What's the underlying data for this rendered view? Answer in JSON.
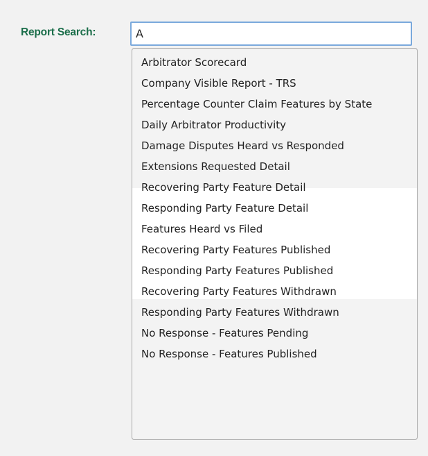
{
  "search": {
    "label": "Report Search:",
    "value": "A"
  },
  "results": [
    "Arbitrator Scorecard",
    "Company Visible Report - TRS",
    "Percentage Counter Claim Features by State",
    "Daily Arbitrator Productivity",
    "Damage Disputes Heard vs Responded",
    "Extensions Requested Detail",
    "Recovering Party Feature Detail",
    "Responding Party Feature Detail",
    "Features Heard vs Filed",
    "Recovering Party Features Published",
    "Responding Party Features Published",
    "Recovering Party Features Withdrawn",
    "Responding Party Features Withdrawn",
    "No Response - Features Pending",
    "No Response - Features Published"
  ],
  "colors": {
    "label": "#1b6e4a",
    "input_border": "#7aa9dc",
    "dropdown_bg": "#f3f3f3",
    "highlight_bg": "#ffffff"
  }
}
